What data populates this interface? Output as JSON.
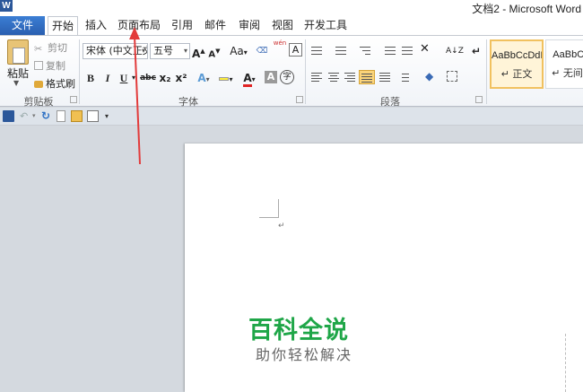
{
  "window": {
    "title": "文档2 - Microsoft Word",
    "app_icon": "word-app-icon"
  },
  "tabs": {
    "file": "文件",
    "items": [
      "开始",
      "插入",
      "页面布局",
      "引用",
      "邮件",
      "审阅",
      "视图",
      "开发工具"
    ],
    "active": "开始"
  },
  "clipboard": {
    "paste": "粘贴",
    "cut": "剪切",
    "copy": "复制",
    "format_painter": "格式刷",
    "group_label": "剪贴板"
  },
  "font": {
    "font_name": "宋体 (中文正文)",
    "font_size": "五号",
    "grow": "A",
    "shrink": "A",
    "change_case": "Aa",
    "bold": "B",
    "italic": "I",
    "underline": "U",
    "strikethrough": "abc",
    "subscript": "x₂",
    "superscript": "x²",
    "text_effect": "A",
    "font_color": "A",
    "char_shading": "A",
    "phonetic": "wén",
    "enclose": "字",
    "group_label": "字体"
  },
  "paragraph": {
    "group_label": "段落",
    "sort": "A↓Z"
  },
  "styles": {
    "items": [
      {
        "sample": "AaBbCcDdI",
        "name": "↵ 正文",
        "selected": true
      },
      {
        "sample": "AaBbCcI",
        "name": "↵ 无间隔",
        "selected": false
      }
    ]
  },
  "document": {
    "paragraph_mark": "↵"
  },
  "watermark": {
    "main": "百科全说",
    "sub": "助你轻松解决"
  },
  "colors": {
    "file_tab": "#2a5fb0",
    "watermark_green": "#1fa648",
    "annotation_red": "#e23b3b"
  }
}
